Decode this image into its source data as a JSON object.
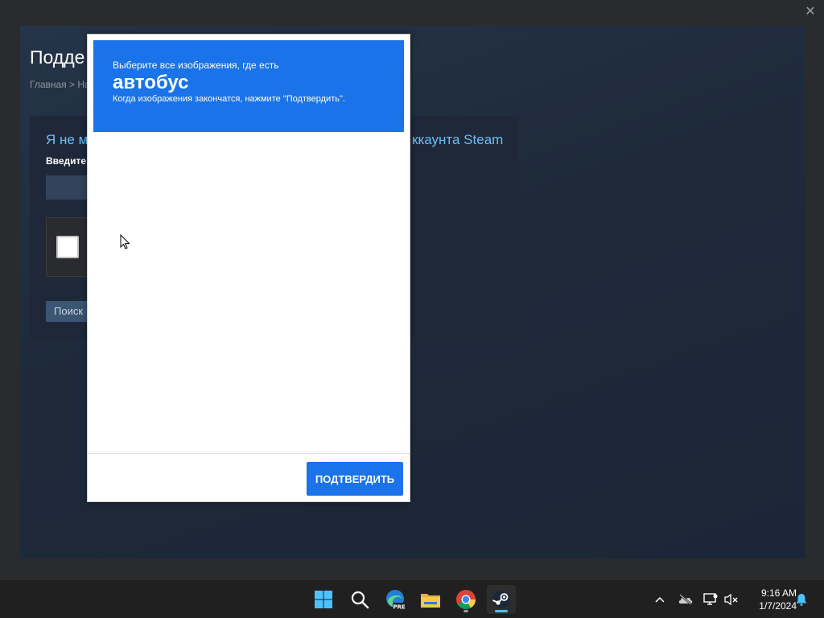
{
  "steam_page": {
    "title": "Подде",
    "breadcrumb": "Главная > На",
    "panel_heading_left": "Я не м",
    "panel_heading_right": "ккаунта Steam",
    "panel_hint": "Введите",
    "search_button": "Поиск"
  },
  "captcha": {
    "instruction": "Выберите все изображения, где есть",
    "target": "автобус",
    "sub_instruction": "Когда изображения закончатся, нажмите \"Подтвердить\".",
    "verify_button": "ПОДТВЕРДИТЬ",
    "accent_color": "#1a73e8"
  },
  "taskbar": {
    "apps": [
      "start-icon",
      "search-icon",
      "edge-icon",
      "file-explorer-icon",
      "chrome-icon",
      "steam-icon"
    ],
    "active_app": "steam-icon",
    "edge_badge": "PRE",
    "time": "9:16 AM",
    "date": "1/7/2024"
  },
  "window": {
    "close_glyph": "✕"
  }
}
